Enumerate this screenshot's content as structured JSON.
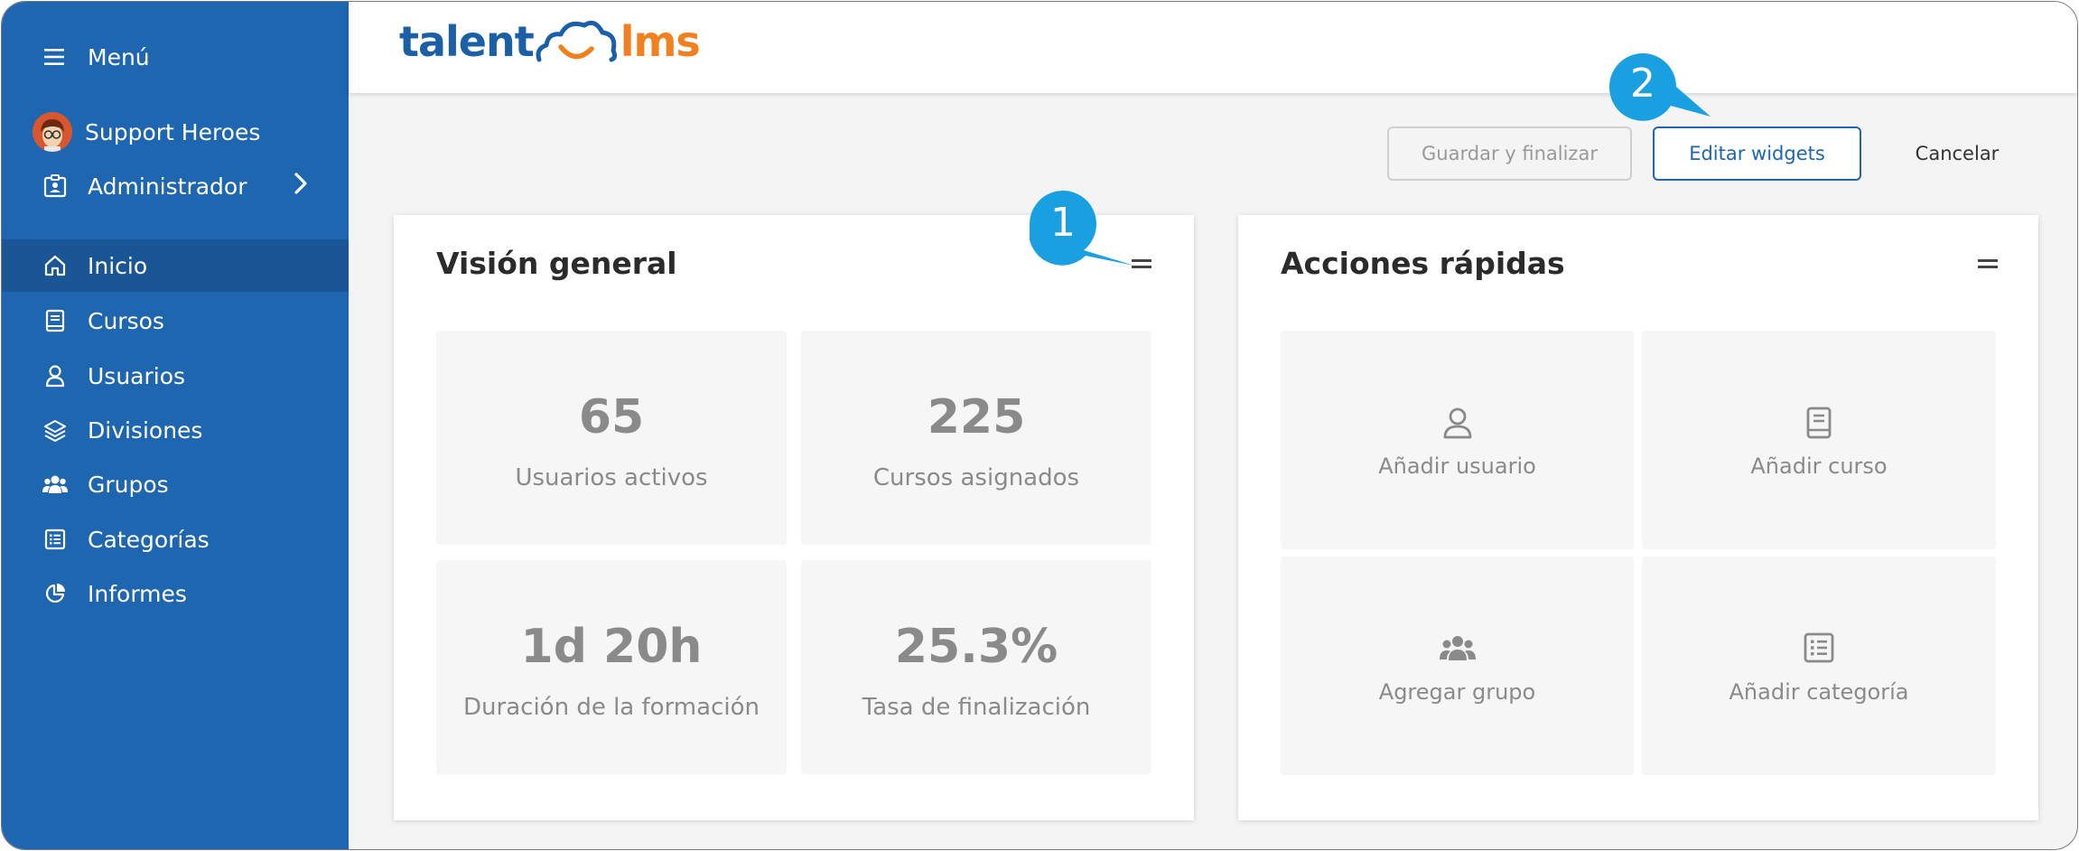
{
  "sidebar": {
    "menu_label": "Menú",
    "user_name": "Support Heroes",
    "role_label": "Administrador",
    "items": [
      {
        "label": "Inicio",
        "icon": "home-icon",
        "active": true
      },
      {
        "label": "Cursos",
        "icon": "book-icon",
        "active": false
      },
      {
        "label": "Usuarios",
        "icon": "user-icon",
        "active": false
      },
      {
        "label": "Divisiones",
        "icon": "layers-icon",
        "active": false
      },
      {
        "label": "Grupos",
        "icon": "group-icon",
        "active": false
      },
      {
        "label": "Categorías",
        "icon": "list-icon",
        "active": false
      },
      {
        "label": "Informes",
        "icon": "pie-chart-icon",
        "active": false
      }
    ]
  },
  "brand": {
    "part1": "talent",
    "part2": "lms",
    "blue": "#1b5fa6",
    "orange": "#f08020"
  },
  "toolbar": {
    "save_label": "Guardar y finalizar",
    "edit_label": "Editar widgets",
    "cancel_label": "Cancelar"
  },
  "overview": {
    "title": "Visión general",
    "stats": [
      {
        "value": "65",
        "label": "Usuarios activos"
      },
      {
        "value": "225",
        "label": "Cursos asignados"
      },
      {
        "value": "1d 20h",
        "label": "Duración de la formación"
      },
      {
        "value": "25.3%",
        "label": "Tasa de finalización"
      }
    ]
  },
  "quick_actions": {
    "title": "Acciones rápidas",
    "items": [
      {
        "label": "Añadir usuario",
        "icon": "user-icon"
      },
      {
        "label": "Añadir curso",
        "icon": "book-icon"
      },
      {
        "label": "Agregar grupo",
        "icon": "group-icon"
      },
      {
        "label": "Añadir categoría",
        "icon": "list-icon"
      }
    ]
  },
  "callouts": {
    "one": "1",
    "two": "2",
    "color": "#1aa0e0"
  },
  "colors": {
    "sidebar": "#1e66b0",
    "sidebar_active": "#1a5595",
    "accent": "#1e66b0"
  }
}
